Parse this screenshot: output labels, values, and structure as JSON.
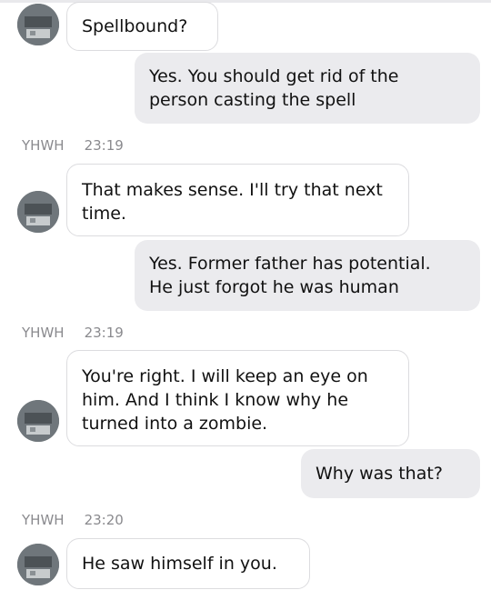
{
  "colors": {
    "incoming_bg": "#ffffff",
    "outgoing_bg": "#ebebee",
    "meta_text": "#8a8a8e"
  },
  "messages": [
    {
      "side": "in",
      "lines": [
        "Spellbound?"
      ]
    },
    {
      "side": "out",
      "lines": [
        "Yes. You should get rid of the",
        "person casting the spell"
      ]
    },
    {
      "side": "meta",
      "sender": "YHWH",
      "time": "23:19"
    },
    {
      "side": "in",
      "lines": [
        "That makes sense. I'll try that next",
        "time."
      ]
    },
    {
      "side": "out",
      "lines": [
        "Yes. Former father has potential.",
        "He just forgot he was human"
      ]
    },
    {
      "side": "meta",
      "sender": "YHWH",
      "time": "23:19"
    },
    {
      "side": "in",
      "lines": [
        "You're right. I will keep an eye on",
        "him. And I think I know why he",
        "turned into a zombie."
      ]
    },
    {
      "side": "out",
      "lines": [
        "Why was that?"
      ]
    },
    {
      "side": "meta",
      "sender": "YHWH",
      "time": "23:20"
    },
    {
      "side": "in",
      "lines": [
        "He saw himself in you."
      ]
    }
  ]
}
